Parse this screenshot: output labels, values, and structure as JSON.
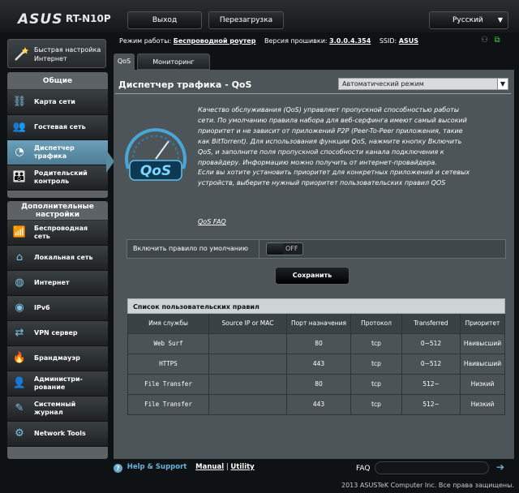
{
  "header": {
    "brand": "ASUS",
    "model": "RT-N10P",
    "logout_label": "Выход",
    "reboot_label": "Перезагрузка",
    "language": "Русский"
  },
  "quick_setup": {
    "line1": "Быстрая настройка",
    "line2": "Интернет"
  },
  "sidebar": {
    "general_title": "Общие",
    "general_items": [
      {
        "label": "Карта сети",
        "icon": "network-map-icon"
      },
      {
        "label": "Гостевая сеть",
        "icon": "guest-network-icon"
      },
      {
        "label": "Диспетчер трафика",
        "icon": "traffic-manager-icon",
        "active": true
      },
      {
        "label": "Родительский контроль",
        "icon": "parental-control-icon"
      }
    ],
    "advanced_title_line1": "Дополнительные",
    "advanced_title_line2": "настройки",
    "advanced_items": [
      {
        "label": "Беспроводная сеть",
        "icon": "wireless-icon"
      },
      {
        "label": "Локальная сеть",
        "icon": "lan-icon"
      },
      {
        "label": "Интернет",
        "icon": "globe-icon"
      },
      {
        "label": "IPv6",
        "icon": "ipv6-icon"
      },
      {
        "label": "VPN сервер",
        "icon": "vpn-icon"
      },
      {
        "label": "Брандмауэр",
        "icon": "firewall-icon"
      },
      {
        "label": "Администри- рование",
        "icon": "administration-icon"
      },
      {
        "label": "Системный журнал",
        "icon": "system-log-icon"
      },
      {
        "label": "Network Tools",
        "icon": "network-tools-icon"
      }
    ]
  },
  "status": {
    "mode_label": "Режим работы:",
    "mode_value": "Беспроводной роутер",
    "fw_label": "Версия прошивки:",
    "fw_value": "3.0.0.4.354",
    "ssid_label": "SSID:",
    "ssid_value": "ASUS"
  },
  "tabs": {
    "qos": "QoS",
    "monitor": "Мониторинг трафика"
  },
  "main": {
    "title": "Диспетчер трафика - QoS",
    "mode_select": "Автоматический  режим",
    "logo_text": "QoS",
    "desc1": "Качество обслуживания (QoS) управляет пропускной способностью работы сети. По умолчанию правила набора для веб-серфинга имеют самый высокий приоритет и не зависит от приложений P2P (Peer-To-Peer приложения, такие как BitTorrent). Для использования функции QoS, нажмите кнопку Включить QoS, и заполните поля пропускной способности канала подключения к провайдеру. Информацию можно получить от интернет-провайдера.",
    "desc2": "Если вы хотите установить приоритет для конкретных приложений и сетевых устройств, выберите нужный приоритет пользовательских правил QOS",
    "faq_link": "QoS FAQ",
    "toggle_label": "Включить правило по умолчанию",
    "toggle_state": "OFF",
    "save_label": "Сохранить"
  },
  "rules": {
    "title": "Список пользовательских правил",
    "headers": [
      "Имя службы",
      "Source IP or MAC",
      "Порт назначения",
      "Протокол",
      "Transferred",
      "Приоритет"
    ],
    "rows": [
      [
        "Web Surf",
        "",
        "80",
        "tcp",
        "0~512",
        "Наивысший"
      ],
      [
        "HTTPS",
        "",
        "443",
        "tcp",
        "0~512",
        "Наивысший"
      ],
      [
        "File Transfer",
        "",
        "80",
        "tcp",
        "512~",
        "Низкий"
      ],
      [
        "File Transfer",
        "",
        "443",
        "tcp",
        "512~",
        "Низкий"
      ]
    ]
  },
  "footer": {
    "help": "Help & Support",
    "manual": "Manual",
    "separator": "|",
    "utility": "Utility",
    "faq": "FAQ",
    "copyright": "2013 ASUSTeK Computer Inc. Все права защищены."
  }
}
